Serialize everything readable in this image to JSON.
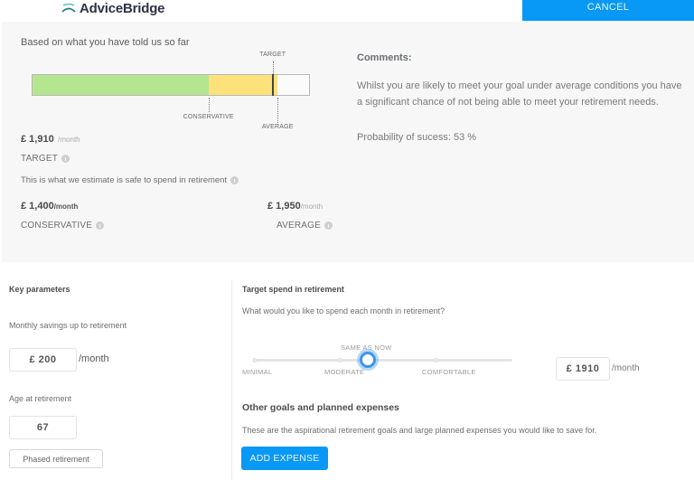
{
  "header": {
    "brand": "AdviceBridge",
    "brand_color": "#2f3147",
    "logo_icon": "bridge-arc-icon",
    "cancel_label": "CANCEL",
    "accent_color": "#0898f5"
  },
  "summary": {
    "title": "Based on what you have told us so far",
    "bar": {
      "scale_max": 2200,
      "conservative_value": 1400,
      "average_value": 1950,
      "target_value": 1910,
      "labels": {
        "target": "TARGET",
        "conservative": "CONSERVATIVE",
        "average": "AVERAGE"
      },
      "colors": {
        "conservative": "#b4e690",
        "average": "#fde17a",
        "target": "#444444"
      }
    },
    "target": {
      "amount": "£ 1,910",
      "unit": "/month",
      "label": "TARGET"
    },
    "estimate_note": "This is what we estimate is safe to spend in retirement",
    "conservative": {
      "amount": "£ 1,400",
      "unit": "/month",
      "label": "CONSERVATIVE"
    },
    "average": {
      "amount": "£ 1,950",
      "unit": "/month",
      "label": "AVERAGE"
    },
    "comments": {
      "title": "Comments:",
      "body": "Whilst you are likely to meet your goal under average conditions you have a significant chance of not being able to meet your retirement needs.",
      "probability": "Probability of sucess: 53 %"
    }
  },
  "key_parameters": {
    "title": "Key parameters",
    "monthly_savings_label": "Monthly savings up to retirement",
    "monthly_savings_value": "£ 200",
    "monthly_savings_unit": "/month",
    "age_label": "Age at retirement",
    "age_value": "67",
    "phased_button": "Phased retirement"
  },
  "target_spend": {
    "title": "Target spend in retirement",
    "question": "What would you like to spend each month in retirement?",
    "slider": {
      "stops": [
        "MINIMAL",
        "MODERATE",
        "COMFORTABLE"
      ],
      "current_label": "SAME AS NOW",
      "position_fraction": 0.44
    },
    "value": "£ 1910",
    "unit": "/month"
  },
  "other_goals": {
    "title": "Other goals and planned expenses",
    "description": "These are the aspirational retirement goals and large planned expenses you would like to save for.",
    "add_button": "ADD EXPENSE"
  }
}
